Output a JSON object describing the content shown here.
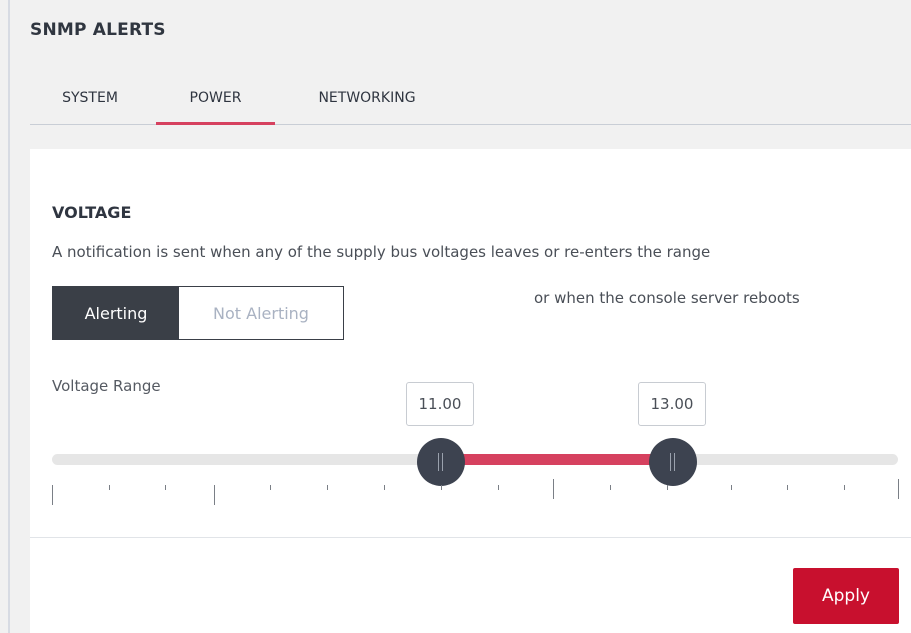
{
  "header": {
    "title": "SNMP ALERTS"
  },
  "tabs": [
    {
      "label": "SYSTEM",
      "active": false
    },
    {
      "label": "POWER",
      "active": true
    },
    {
      "label": "NETWORKING",
      "active": false
    }
  ],
  "voltage": {
    "title": "VOLTAGE",
    "description_line1": "A notification is sent when any of the supply bus voltages leaves or re-enters the range",
    "description_line2": "or when the console server reboots",
    "toggle": {
      "on_label": "Alerting",
      "off_label": "Not Alerting",
      "selected": "Alerting"
    },
    "range_label": "Voltage Range",
    "range_min_value": "11.00",
    "range_max_value": "13.00"
  },
  "actions": {
    "apply_label": "Apply"
  },
  "colors": {
    "accent": "#d6415f",
    "apply": "#c8102e",
    "dark": "#3a3f47"
  }
}
